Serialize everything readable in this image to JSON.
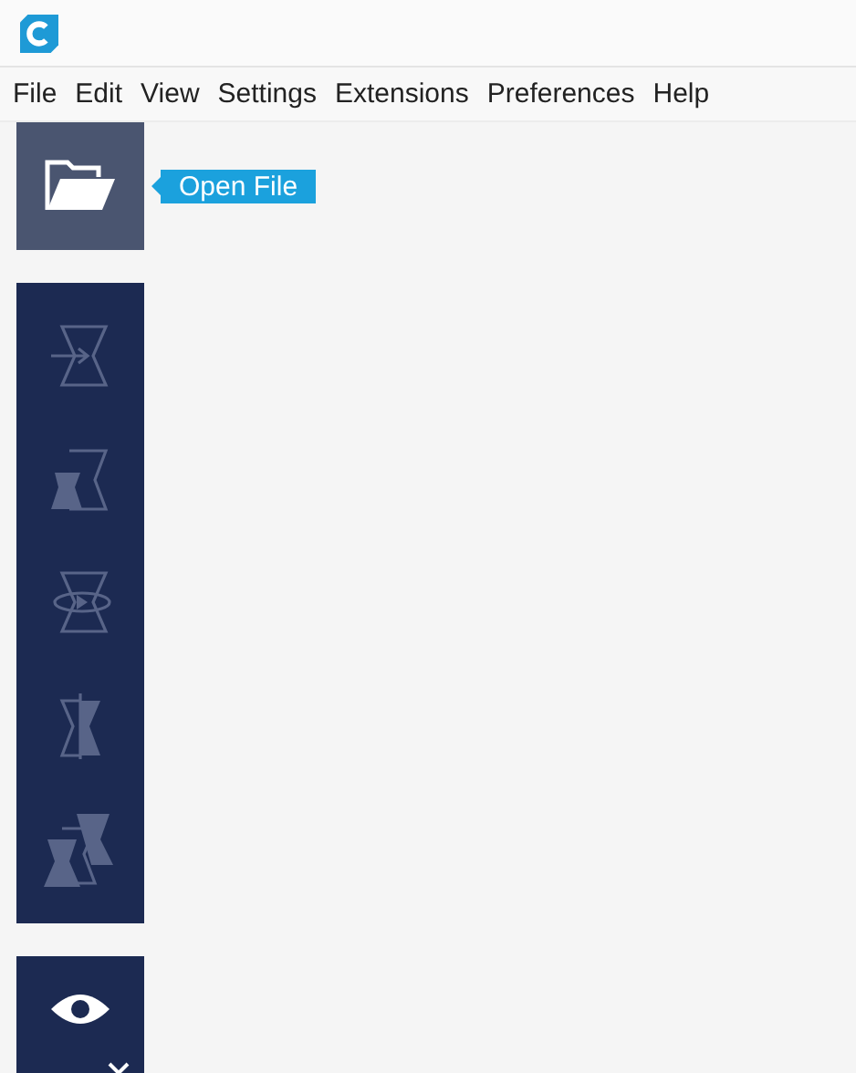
{
  "menu_bar": {
    "items": [
      "File",
      "Edit",
      "View",
      "Settings",
      "Extensions",
      "Preferences",
      "Help"
    ]
  },
  "open_file": {
    "tooltip": "Open File"
  },
  "tools": [
    {
      "kind": "move",
      "disabled": true
    },
    {
      "kind": "scale",
      "disabled": true
    },
    {
      "kind": "rotate",
      "disabled": true
    },
    {
      "kind": "mirror",
      "disabled": true
    },
    {
      "kind": "per-model",
      "disabled": true
    }
  ]
}
